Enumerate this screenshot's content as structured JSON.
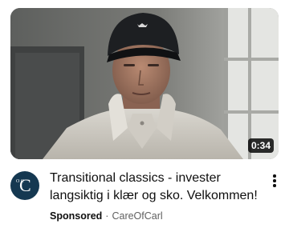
{
  "video": {
    "duration": "0:34",
    "title": "Transitional classics - invester langsiktig i klær og sko. Velkommen!",
    "thumbnail_icon": "video-thumbnail"
  },
  "channel": {
    "avatar_monogram": "C",
    "avatar_small_letters": "O C",
    "name": "CareOfCarl",
    "avatar_color": "#153851"
  },
  "meta": {
    "sponsored_label": "Sponsored",
    "separator": "·"
  },
  "menu": {
    "icon": "more-vert-icon"
  }
}
